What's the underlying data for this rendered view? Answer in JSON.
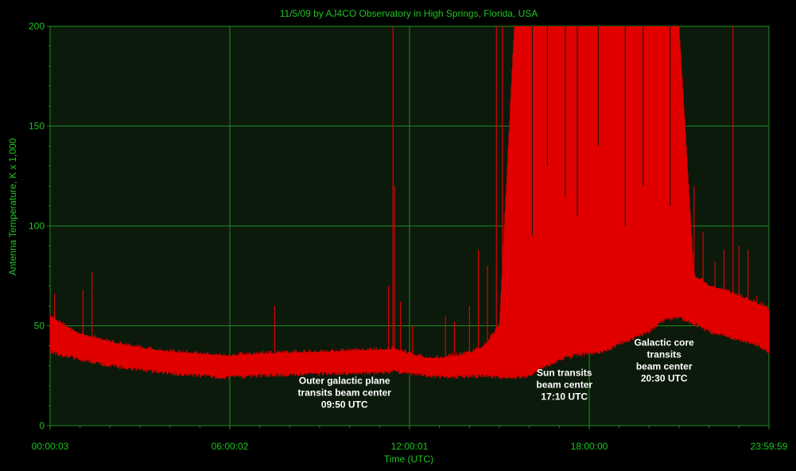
{
  "chart_data": {
    "type": "line",
    "title": "11/5/09  by  AJ4CO Observatory  in  High Springs, Florida, USA",
    "xlabel": "Time (UTC)",
    "ylabel": "Antenna Temperature, K x 1,000",
    "ylim": [
      0,
      200
    ],
    "xlim_hours": [
      0.00083,
      23.9997
    ],
    "x_tick_labels": [
      {
        "hour": 0.00083,
        "label": "00:00:03"
      },
      {
        "hour": 6.0006,
        "label": "06:00:02"
      },
      {
        "hour": 12.0003,
        "label": "12:00:01"
      },
      {
        "hour": 18.0,
        "label": "18:00:00"
      },
      {
        "hour": 23.9997,
        "label": "23:59:59"
      }
    ],
    "y_ticks": [
      0,
      50,
      100,
      150,
      200
    ],
    "grid": true,
    "colors": {
      "background": "#000000",
      "plot_background": "#0b1a0b",
      "grid": "#1e8c1e",
      "text": "#1fc41f",
      "series": "#e00000",
      "annotation": "#ffffff"
    },
    "series": [
      {
        "envelope_hours": [
          0,
          0.5,
          1,
          2,
          3,
          4,
          5,
          6,
          7,
          8,
          9,
          10,
          11,
          11.5,
          12,
          12.5,
          13,
          13.5,
          14,
          14.5,
          15,
          15.5,
          16,
          16.5,
          17,
          17.5,
          18,
          18.5,
          19,
          19.5,
          20,
          20.5,
          21,
          21.5,
          22,
          22.5,
          23,
          23.5,
          24
        ],
        "lower": [
          38,
          36,
          34,
          31,
          29,
          27,
          26,
          25,
          26,
          26.5,
          27,
          27,
          27.5,
          28,
          27,
          26,
          25.5,
          25.5,
          25.5,
          26,
          25,
          25,
          26,
          30,
          34,
          36,
          37,
          38,
          42,
          45,
          48,
          54,
          55,
          52,
          48,
          46,
          44,
          42,
          38
        ],
        "upper": [
          55,
          50,
          46,
          42,
          39,
          37,
          36,
          35,
          36,
          36.5,
          37,
          37.5,
          38,
          38.5,
          36,
          34,
          34,
          35,
          36,
          40,
          50,
          200,
          200,
          200,
          200,
          200,
          200,
          200,
          200,
          200,
          200,
          200,
          200,
          75,
          70,
          68,
          65,
          62,
          58
        ],
        "spikes": [
          [
            0.15,
            66
          ],
          [
            1.1,
            68
          ],
          [
            1.4,
            77
          ],
          [
            7.5,
            60
          ],
          [
            11.3,
            70
          ],
          [
            11.45,
            200
          ],
          [
            11.5,
            120
          ],
          [
            11.7,
            62
          ],
          [
            12.1,
            50
          ],
          [
            13.2,
            55
          ],
          [
            13.5,
            52
          ],
          [
            14.0,
            60
          ],
          [
            14.3,
            88
          ],
          [
            14.6,
            80
          ],
          [
            14.9,
            200
          ],
          [
            15.1,
            200
          ],
          [
            15.3,
            95
          ],
          [
            21.5,
            120
          ],
          [
            21.8,
            97
          ],
          [
            22.2,
            82
          ],
          [
            22.5,
            88
          ],
          [
            22.8,
            200
          ],
          [
            23.0,
            90
          ],
          [
            23.3,
            88
          ],
          [
            23.6,
            65
          ],
          [
            23.8,
            62
          ]
        ]
      }
    ],
    "annotations": [
      {
        "lines": [
          "Outer galactic plane",
          "transits beam center",
          "09:50 UTC"
        ],
        "hour": 9.83,
        "y": 21
      },
      {
        "lines": [
          "Sun transits",
          "beam center",
          "17:10 UTC"
        ],
        "hour": 17.17,
        "y": 25
      },
      {
        "lines": [
          "Galactic core",
          "transits",
          "beam center",
          "20:30 UTC"
        ],
        "hour": 20.5,
        "y": 40
      }
    ]
  }
}
